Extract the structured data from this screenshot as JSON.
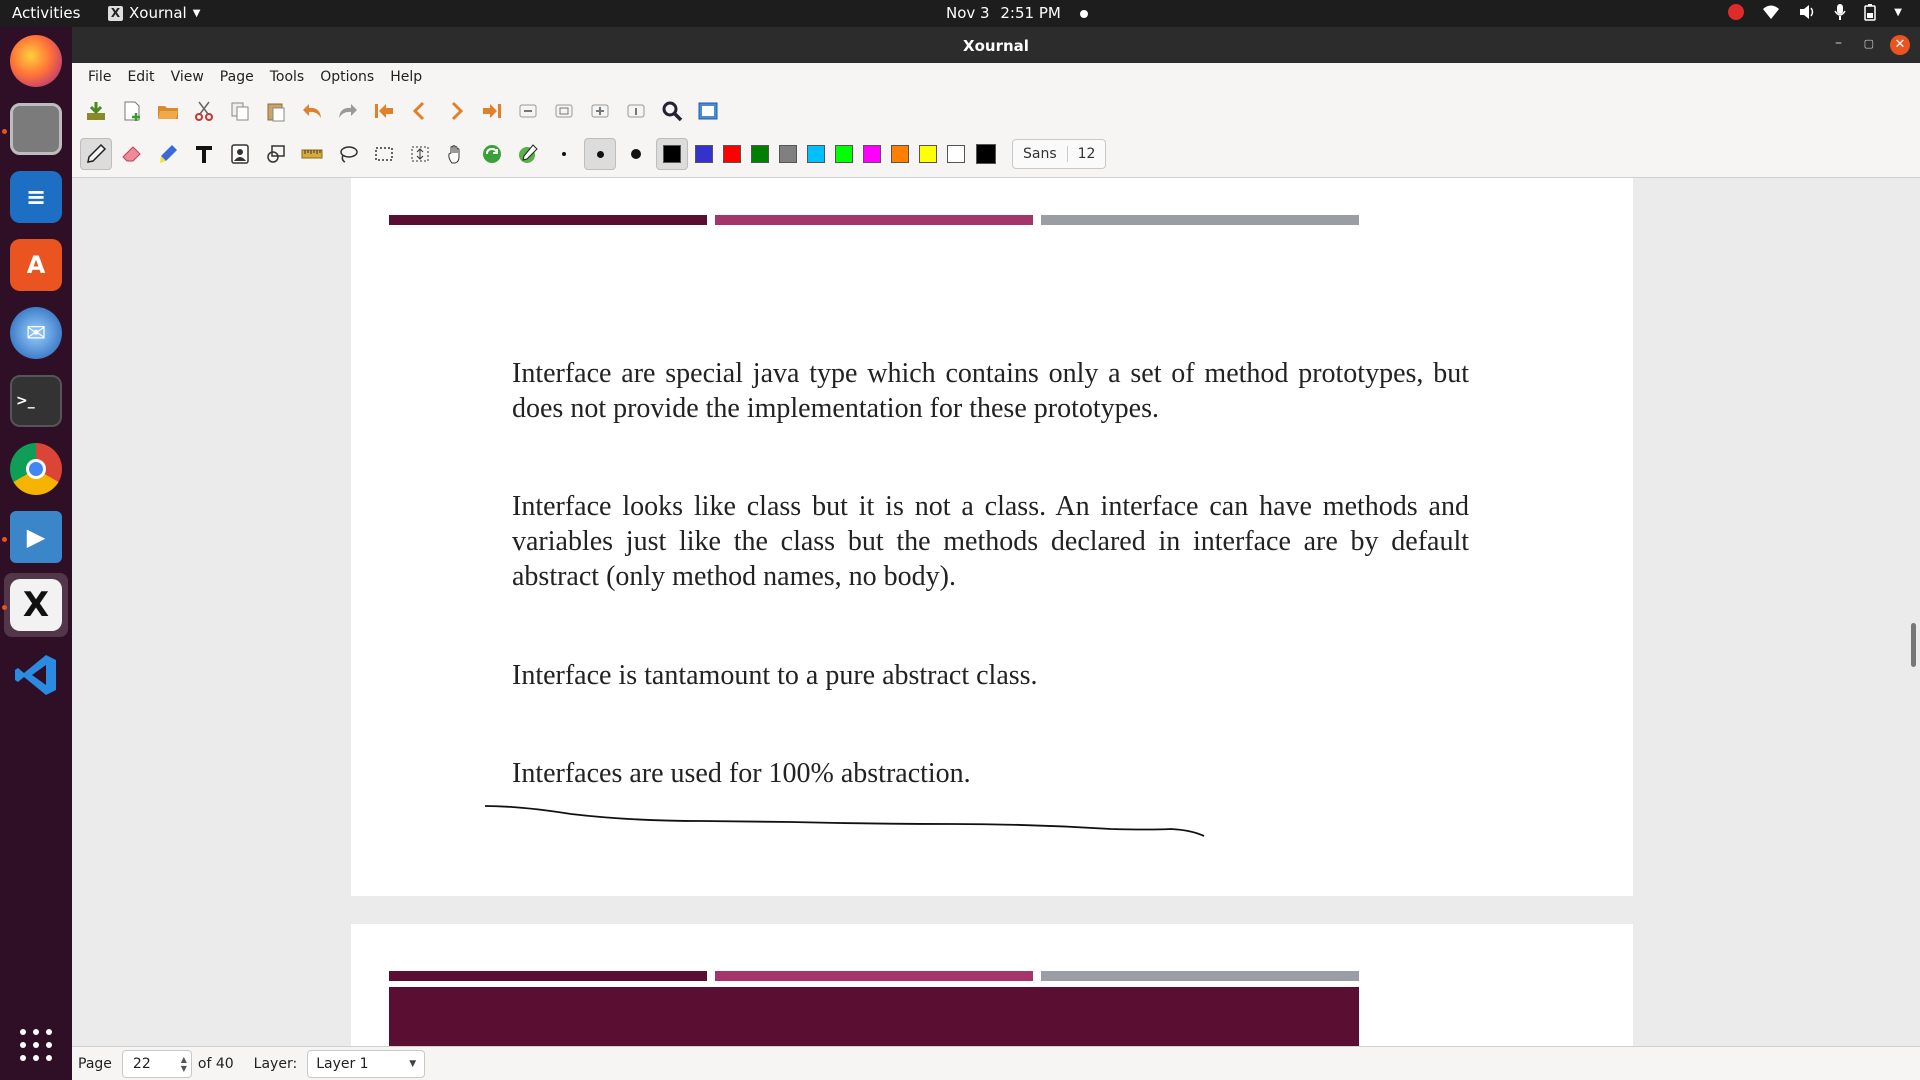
{
  "topbar": {
    "activities": "Activities",
    "app_name": "Xournal",
    "date": "Nov 3",
    "time": "2:51 PM"
  },
  "window": {
    "title": "Xournal"
  },
  "menu": {
    "items": [
      "File",
      "Edit",
      "View",
      "Page",
      "Tools",
      "Options",
      "Help"
    ]
  },
  "font": {
    "name": "Sans",
    "size": "12"
  },
  "colors": {
    "swatches": [
      "#000000",
      "#3333cc",
      "#ff0000",
      "#008000",
      "#808080",
      "#00c0ff",
      "#00ff00",
      "#ff00ff",
      "#ff8000",
      "#ffff00",
      "#ffffff"
    ],
    "current": "#000000",
    "bar_dark": "#5a0f32",
    "bar_mid": "#a3356a",
    "bar_gray": "#9a9ea4"
  },
  "document": {
    "paragraphs": [
      "Interface are special java type which contains only a set of method prototypes, but does not provide the implementation for these prototypes.",
      "Interface looks like class but it is not a class. An interface can have methods and variables just like the class but the methods declared in interface are by default abstract (only method names, no body).",
      "Interface is tantamount to a pure abstract class.",
      "Interfaces are used for 100% abstraction."
    ]
  },
  "status": {
    "page_label": "Page",
    "page_value": "22",
    "of_label": "of 40",
    "layer_label": "Layer:",
    "layer_value": "Layer 1"
  }
}
